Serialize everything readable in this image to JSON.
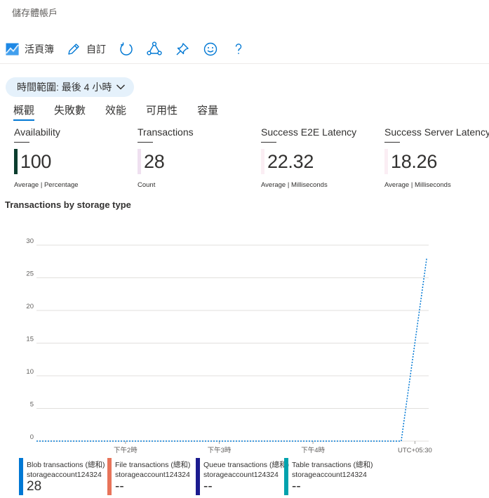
{
  "breadcrumb": "儲存體帳戶",
  "toolbar": {
    "workbook_label": "活頁簿",
    "customize_label": "自訂"
  },
  "time_range": "時間範圍: 最後 4 小時",
  "tabs": [
    {
      "label": "概觀",
      "active": true
    },
    {
      "label": "失敗數",
      "active": false
    },
    {
      "label": "效能",
      "active": false
    },
    {
      "label": "可用性",
      "active": false
    },
    {
      "label": "容量",
      "active": false
    }
  ],
  "metrics": [
    {
      "title": "Availability",
      "value": "100",
      "sub": "Average | Percentage",
      "bar_color": "#0b3d2e"
    },
    {
      "title": "Transactions",
      "value": "28",
      "sub": "Count",
      "bar_color": "#efe0f0"
    },
    {
      "title": "Success E2E Latency",
      "value": "22.32",
      "sub": "Average | Milliseconds",
      "bar_color": "#fbeef4"
    },
    {
      "title": "Success Server Latency",
      "value": "18.26",
      "sub": "Average | Milliseconds",
      "bar_color": "#fbeef4"
    }
  ],
  "chart_title": "Transactions by storage type",
  "chart_data": {
    "type": "line",
    "title": "Transactions by storage type",
    "y_ticks": [
      "30",
      "25",
      "20",
      "15",
      "10",
      "5",
      "0"
    ],
    "ylim": [
      0,
      30
    ],
    "x_ticks": [
      "下午2時",
      "下午3時",
      "下午4時",
      "UTC+05:30"
    ],
    "grid": true,
    "series": [
      {
        "name": "Blob transactions (總和)",
        "color": "#0078d4",
        "style": "dotted",
        "points": [
          {
            "t": 0.0,
            "v": 0
          },
          {
            "t": 0.93,
            "v": 0
          },
          {
            "t": 0.995,
            "v": 28
          }
        ]
      }
    ]
  },
  "legend": [
    {
      "name": "Blob transactions (總和)",
      "sub": "storageaccount124324",
      "value": "28",
      "color": "#0078d4"
    },
    {
      "name": "File transactions (總和)",
      "sub": "storageaccount124324",
      "value": "--",
      "color": "#e8745a"
    },
    {
      "name": "Queue transactions (總和)",
      "sub": "storageaccount124324",
      "value": "--",
      "color": "#1b1b8f"
    },
    {
      "name": "Table transactions (總和)",
      "sub": "storageaccount124324",
      "value": "--",
      "color": "#00a2ad"
    }
  ]
}
